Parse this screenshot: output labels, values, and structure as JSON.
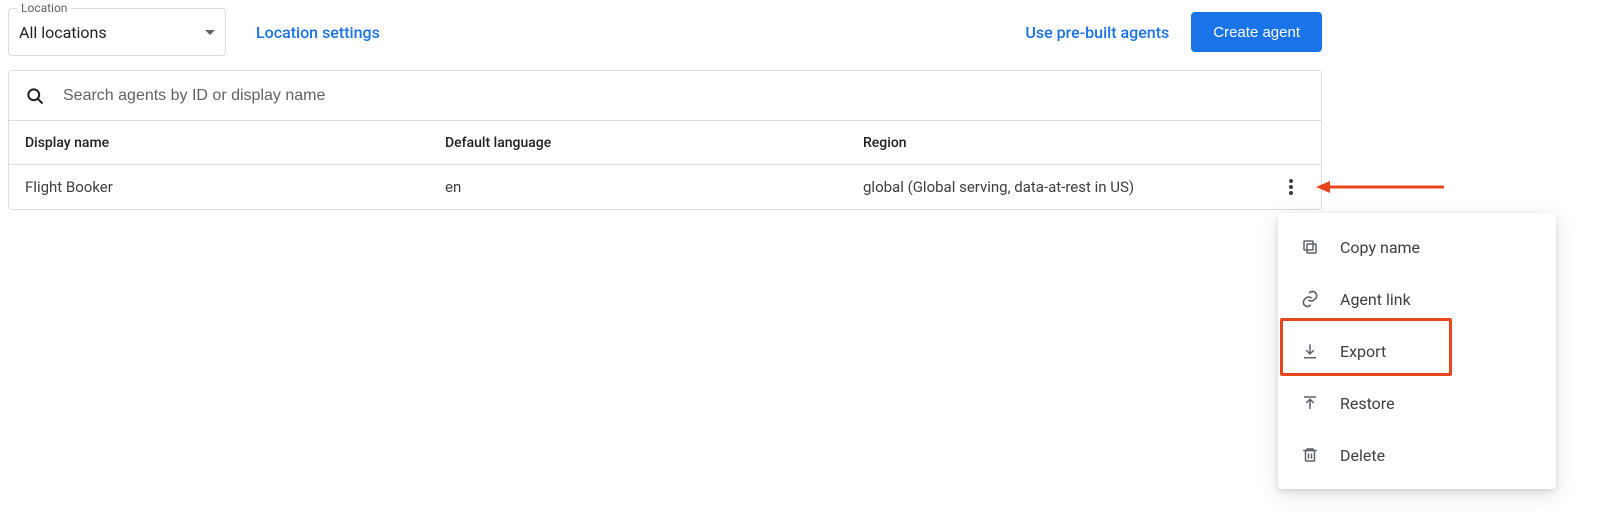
{
  "topbar": {
    "location_label": "Location",
    "location_value": "All locations",
    "location_settings": "Location settings",
    "prebuilt": "Use pre-built agents",
    "create": "Create agent"
  },
  "search": {
    "placeholder": "Search agents by ID or display name"
  },
  "table": {
    "headers": {
      "display_name": "Display name",
      "default_language": "Default language",
      "region": "Region"
    },
    "rows": [
      {
        "display_name": "Flight Booker",
        "default_language": "en",
        "region": "global (Global serving, data-at-rest in US)"
      }
    ]
  },
  "menu": {
    "copy_name": "Copy name",
    "agent_link": "Agent link",
    "export": "Export",
    "restore": "Restore",
    "delete": "Delete"
  }
}
